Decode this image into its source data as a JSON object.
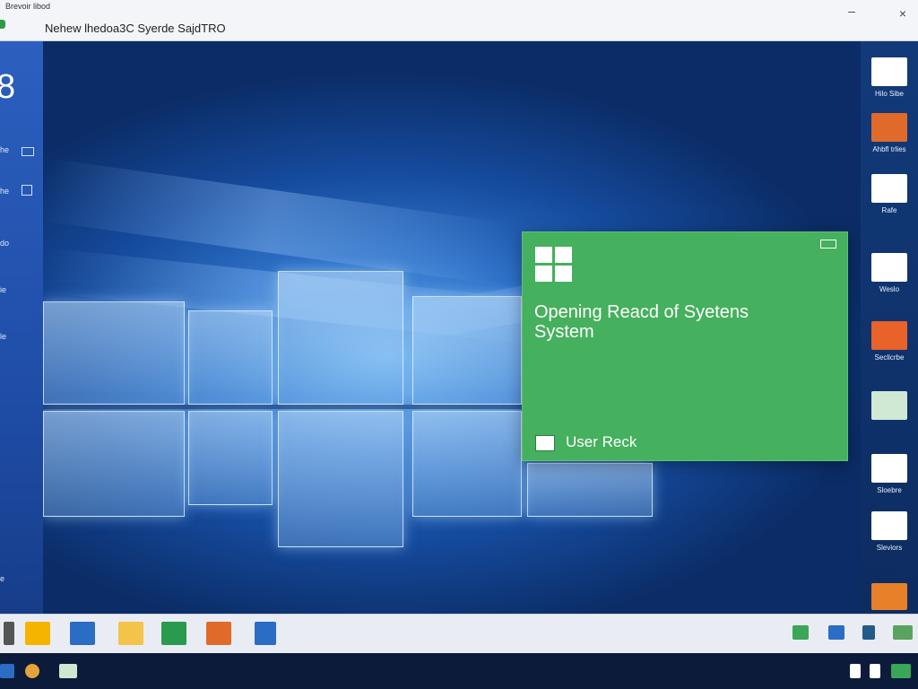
{
  "window": {
    "mini_label": "Brevoir libod",
    "title": "Nehew lhedoa3C Syerde SajdTRO",
    "minimize_glyph": "–",
    "close_glyph": "×"
  },
  "sidebar": {
    "digit": "8",
    "items": [
      {
        "label": "he",
        "icon": "monitor-icon"
      },
      {
        "label": "he",
        "icon": "window-icon"
      },
      {
        "label": "do",
        "icon": "none"
      },
      {
        "label": "ie",
        "icon": "none"
      },
      {
        "label": "le",
        "icon": "none"
      },
      {
        "label": "e",
        "icon": "none"
      }
    ]
  },
  "panel": {
    "title": "Opening Reacd of Syetens",
    "subtitle": "System",
    "action_label": "User Reck",
    "color": "#45b05d"
  },
  "rail": {
    "items": [
      {
        "label": "Hilo Sibe",
        "icon": "files-icon",
        "color": "#ffffff"
      },
      {
        "label": "Ahbfl trlies",
        "icon": "office-icon",
        "color": "#e06a2a"
      },
      {
        "label": "Rafe",
        "icon": "document-icon",
        "color": "#ffffff"
      },
      {
        "label": "Weslo",
        "icon": "store-icon",
        "color": "#ffffff"
      },
      {
        "label": "Seclicrbe",
        "icon": "presentation-icon",
        "color": "#e8622a"
      },
      {
        "label": "",
        "icon": "calendar-icon",
        "color": "#cfe9d5"
      },
      {
        "label": "Sloebre",
        "icon": "photos-icon",
        "color": "#ffffff"
      },
      {
        "label": "Sleviors",
        "icon": "contacts-icon",
        "color": "#ffffff"
      },
      {
        "label": "",
        "icon": "chart-icon",
        "color": "#e8802a"
      }
    ]
  },
  "taskbar": {
    "icons": [
      {
        "name": "arrow-left-icon",
        "color": "#555555"
      },
      {
        "name": "pinwheel-icon",
        "color": "#f5b400"
      },
      {
        "name": "mail-icon",
        "color": "#2b6cc4"
      },
      {
        "name": "folder-icon",
        "color": "#f3c34a"
      },
      {
        "name": "excel-icon",
        "color": "#2a9a4e"
      },
      {
        "name": "picture-icon",
        "color": "#e06a2a"
      },
      {
        "name": "store-icon",
        "color": "#2b6cc4"
      },
      {
        "name": "green-app-icon",
        "color": "#3aa657"
      },
      {
        "name": "window-icon",
        "color": "#2b6cc4"
      },
      {
        "name": "dark-app-icon",
        "color": "#245a8a"
      },
      {
        "name": "grid-icon",
        "color": "#5aa35f"
      }
    ]
  },
  "systray": {
    "icons": [
      {
        "name": "start-icon",
        "color": "#2b6cc4"
      },
      {
        "name": "browser-icon",
        "color": "#e6a23a"
      },
      {
        "name": "notes-icon",
        "color": "#cfe7cf"
      },
      {
        "name": "speaker-icon",
        "color": "#ffffff"
      },
      {
        "name": "network-icon",
        "color": "#ffffff"
      },
      {
        "name": "apps-grid-icon",
        "color": "#3aa657"
      }
    ]
  }
}
